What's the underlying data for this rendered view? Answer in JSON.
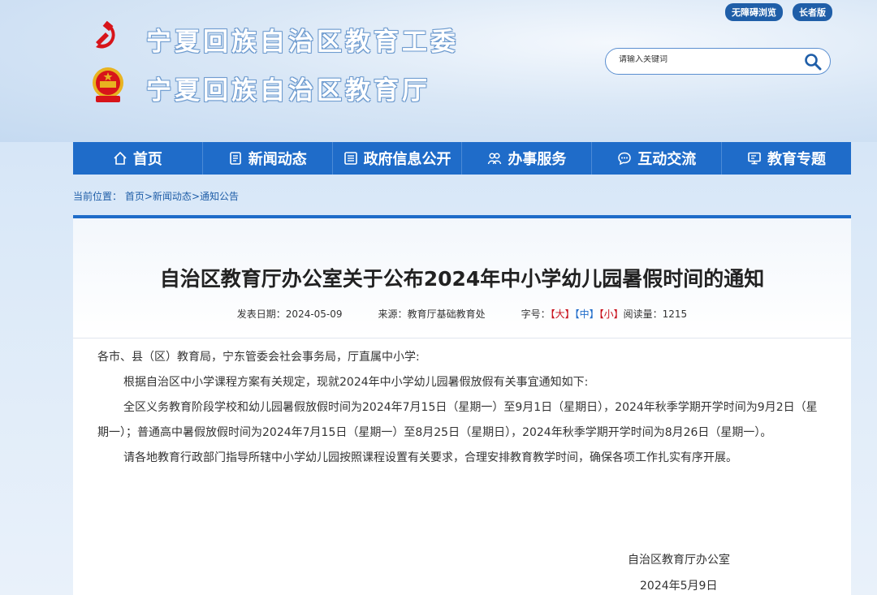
{
  "top_links": {
    "accessibility": "无障碍浏览",
    "elder": "长者版"
  },
  "site": {
    "title_party": "宁夏回族自治区教育工委",
    "title_dept": "宁夏回族自治区教育厅"
  },
  "search": {
    "placeholder": "请输入关键词"
  },
  "nav": [
    {
      "label": "首页",
      "icon": "home-icon"
    },
    {
      "label": "新闻动态",
      "icon": "news-icon"
    },
    {
      "label": "政府信息公开",
      "icon": "document-icon"
    },
    {
      "label": "办事服务",
      "icon": "people-icon"
    },
    {
      "label": "互动交流",
      "icon": "chat-icon"
    },
    {
      "label": "教育专题",
      "icon": "monitor-icon"
    }
  ],
  "breadcrumb": {
    "prefix": "当前位置：",
    "items": [
      "首页",
      "新闻动态",
      "通知公告"
    ],
    "sep": ">"
  },
  "article": {
    "title": "自治区教育厅办公室关于公布2024年中小学幼儿园暑假时间的通知",
    "date_label": "发表日期：",
    "date": "2024-05-09",
    "source_label": "来源：",
    "source": "教育厅基础教育处",
    "font_label": "字号：",
    "font_big": "【大】",
    "font_mid": "【中】",
    "font_small": "【小】",
    "read_label": "阅读量：",
    "read_count": "1215",
    "salutation": "各市、县（区）教育局，宁东管委会社会事务局，厅直属中小学:",
    "para1": "根据自治区中小学课程方案有关规定，现就2024年中小学幼儿园暑假放假有关事宜通知如下:",
    "para2": "全区义务教育阶段学校和幼儿园暑假放假时间为2024年7月15日（星期一）至9月1日（星期日），2024年秋季学期开学时间为9月2日（星期一）；普通高中暑假放假时间为2024年7月15日（星期一）至8月25日（星期日），2024年秋季学期开学时间为8月26日（星期一）。",
    "para3": "请各地教育行政部门指导所辖中小学幼儿园按照课程设置有关要求，合理安排教育教学时间，确保各项工作扎实有序开展。",
    "sign_org": "自治区教育厅办公室",
    "sign_date": "2024年5月9日"
  },
  "colors": {
    "nav_blue": "#1f6cc9",
    "dark_blue": "#1f5ea8",
    "red": "#c8101b"
  }
}
